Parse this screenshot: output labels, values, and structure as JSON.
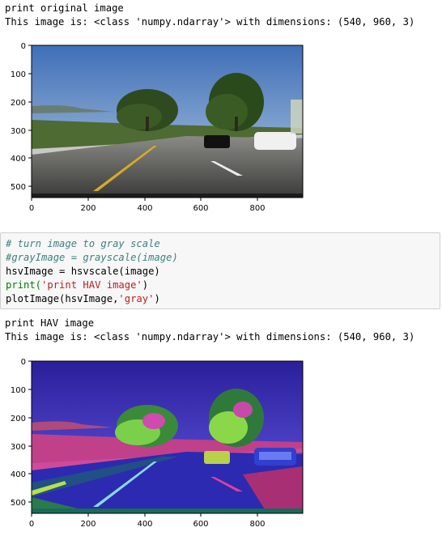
{
  "output1": {
    "line1": "print original image",
    "line2": "This image is: <class 'numpy.ndarray'> with dimensions: (540, 960, 3)"
  },
  "plot1": {
    "yticks": [
      "0",
      "100",
      "200",
      "300",
      "400",
      "500"
    ],
    "xticks": [
      "0",
      "200",
      "400",
      "600",
      "800"
    ]
  },
  "code_cell": {
    "line1": "# turn image to gray scale",
    "line2": "#grayImage = grayscale(image)",
    "line3": "hsvImage = hsvscale(image)",
    "line4_fn": "print(",
    "line4_str": "'print HAV image'",
    "line4_end": ")",
    "line5_fn": "plotImage(hsvImage,",
    "line5_str": "'gray'",
    "line5_end": ")"
  },
  "output2": {
    "line1": "print HAV image",
    "line2": "This image is: <class 'numpy.ndarray'> with dimensions: (540, 960, 3)"
  },
  "plot2": {
    "yticks": [
      "0",
      "100",
      "200",
      "300",
      "400",
      "500"
    ],
    "xticks": [
      "0",
      "200",
      "400",
      "600",
      "800"
    ]
  }
}
